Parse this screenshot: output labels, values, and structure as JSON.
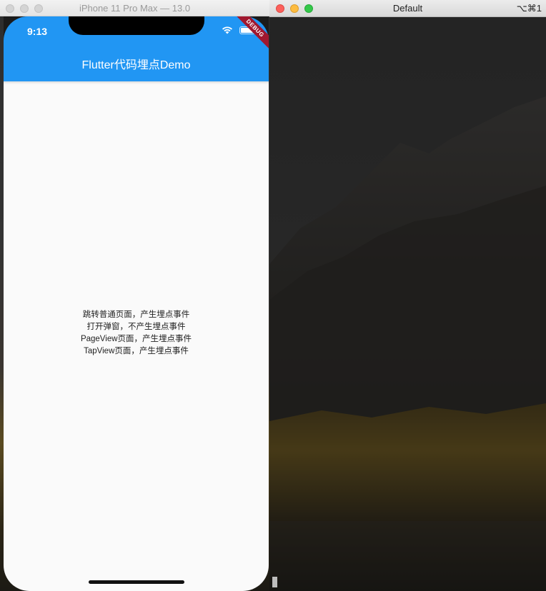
{
  "simulator": {
    "window_title": "iPhone 11 Pro Max — 13.0",
    "status_time": "9:13",
    "debug_banner": "DEBUG",
    "appbar_title": "Flutter代码埋点Demo",
    "links": [
      "跳转普通页面，产生埋点事件",
      "打开弹窗，不产生埋点事件",
      "PageView页面，产生埋点事件",
      "TapView页面，产生埋点事件"
    ]
  },
  "terminal": {
    "window_title": "Default",
    "shortcut": "⌥⌘1"
  },
  "colors": {
    "appbar": "#2196f3",
    "debug_banner": "#a0182f"
  }
}
